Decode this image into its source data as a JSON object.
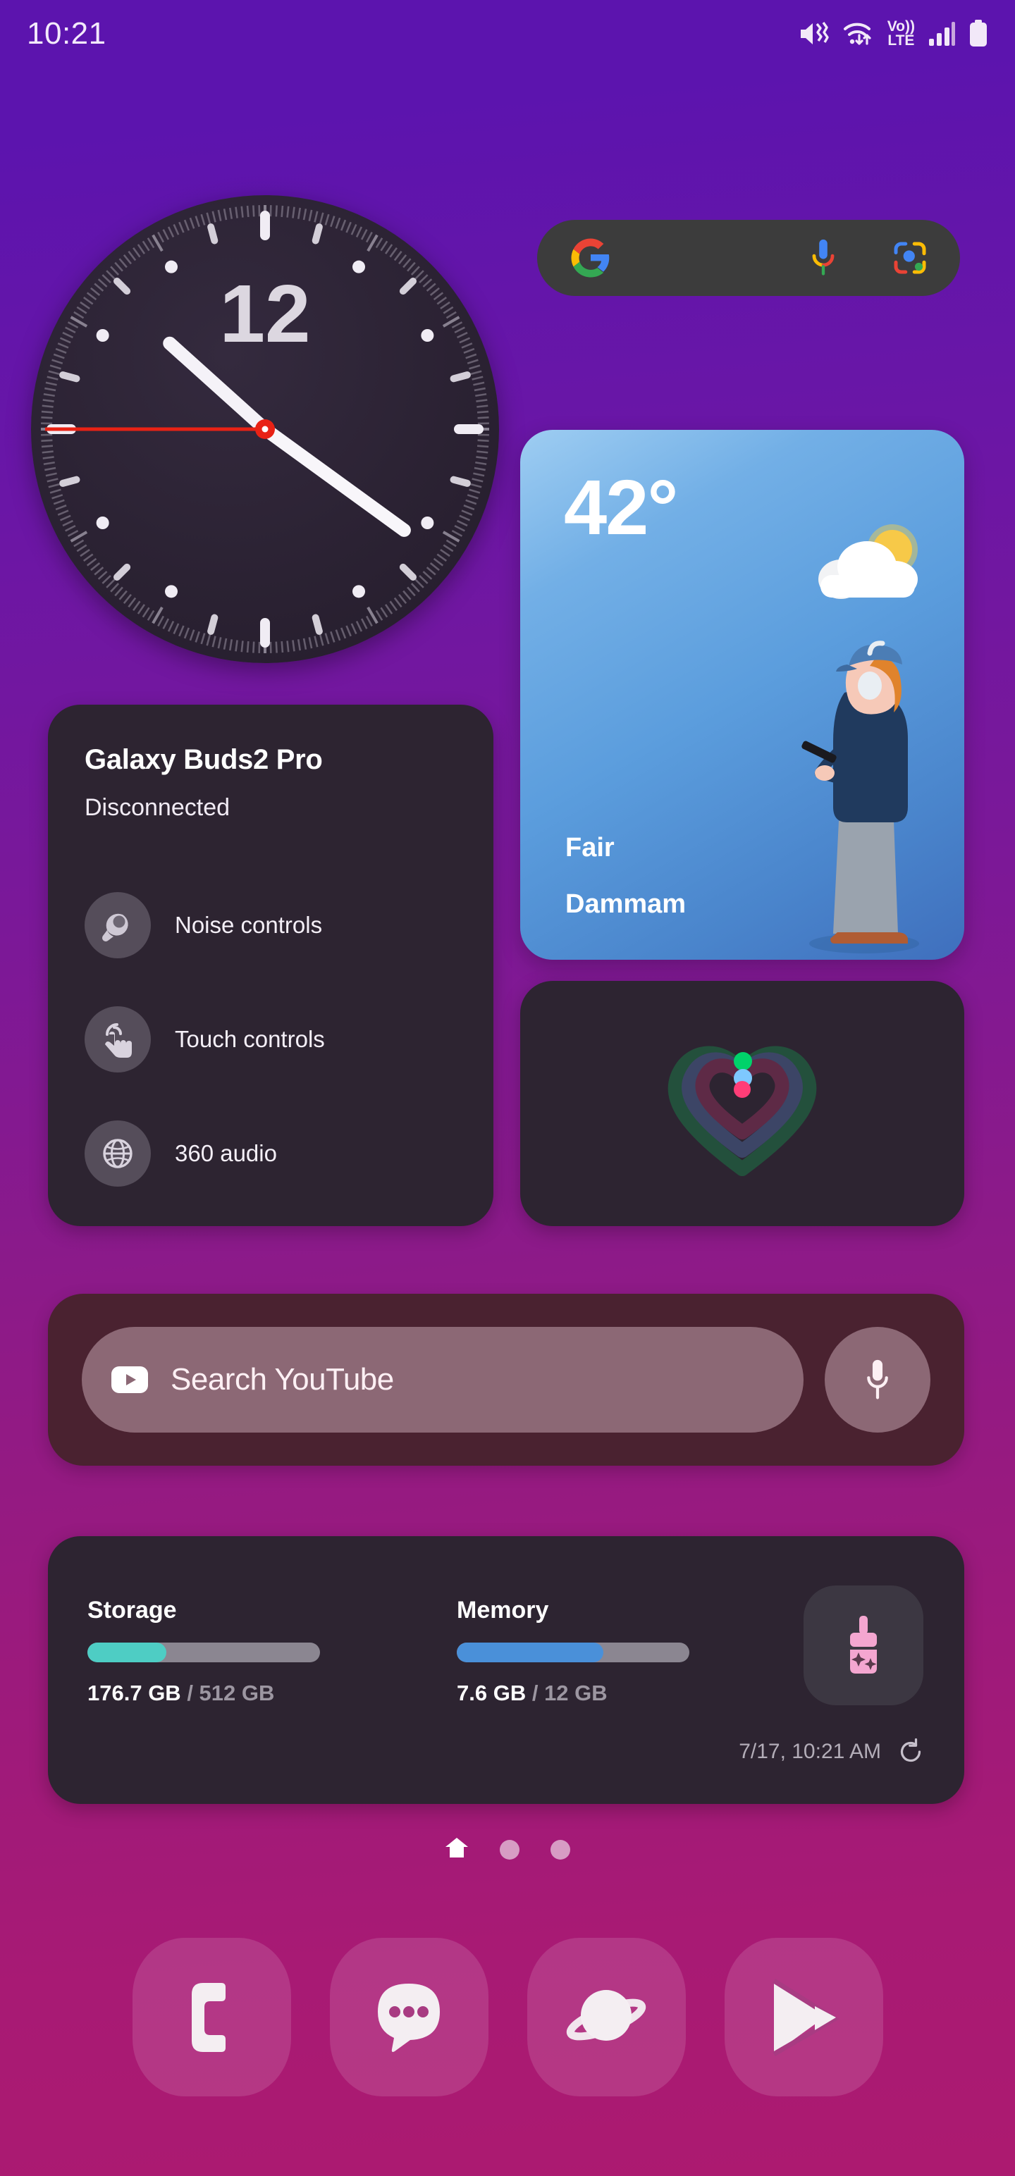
{
  "status_bar": {
    "time": "10:21",
    "icons": [
      "mute-vibrate-icon",
      "wifi-data-icon",
      "volte-icon",
      "signal-bars-icon",
      "battery-icon"
    ],
    "volte_label_top": "Vo))",
    "volte_label_bottom": "LTE"
  },
  "clock_widget": {
    "name": "analog-clock",
    "hour_marker_label": "12",
    "hour_hand_angle_deg": 312,
    "minute_hand_angle_deg": 126,
    "second_hand_angle_deg": 270,
    "face_color": "#2b2233"
  },
  "google_search": {
    "logo": "google-g-icon",
    "mic": "microphone-icon",
    "lens": "google-lens-icon"
  },
  "weather": {
    "temperature": "42°",
    "condition": "Fair",
    "city": "Dammam",
    "icon": "sun-behind-cloud-icon",
    "illustration": "person-with-phone-illustration"
  },
  "buds": {
    "title": "Galaxy Buds2 Pro",
    "status": "Disconnected",
    "controls": [
      {
        "label": "Noise controls",
        "icon": "earbud-icon"
      },
      {
        "label": "Touch controls",
        "icon": "touch-hand-icon"
      },
      {
        "label": "360 audio",
        "icon": "globe-360-icon"
      }
    ]
  },
  "health": {
    "name": "activity-heart-rings",
    "rings": [
      {
        "name": "steps",
        "color": "#00d26a"
      },
      {
        "name": "activity",
        "color": "#7ec8ff"
      },
      {
        "name": "heart",
        "color": "#ff3d77"
      }
    ]
  },
  "youtube": {
    "placeholder": "Search YouTube",
    "logo": "youtube-play-icon",
    "mic": "microphone-icon"
  },
  "storage_widget": {
    "meters": [
      {
        "label": "Storage",
        "used": "176.7 GB",
        "total": "/ 512 GB",
        "percent": 34,
        "color": "#4ecdc4"
      },
      {
        "label": "Memory",
        "used": "7.6 GB",
        "total": "/ 12 GB",
        "percent": 63,
        "color": "#4a90d9"
      }
    ],
    "clean_button_icon": "broom-clean-icon",
    "updated_text": "7/17, 10:21 AM",
    "refresh_icon": "refresh-icon"
  },
  "page_indicator": {
    "pages": 3,
    "active_index": 0,
    "active_icon": "home-icon"
  },
  "dock": [
    {
      "label": "Phone",
      "icon": "phone-icon"
    },
    {
      "label": "Messages",
      "icon": "message-bubble-icon"
    },
    {
      "label": "Internet",
      "icon": "planet-browser-icon"
    },
    {
      "label": "Play Store",
      "icon": "play-store-icon"
    }
  ],
  "theme": {
    "wallpaper_top": "#5c14ae",
    "wallpaper_bottom": "#ac1a70",
    "widget_dark": "#2d2431",
    "accent_pink": "#f4a6d0"
  }
}
